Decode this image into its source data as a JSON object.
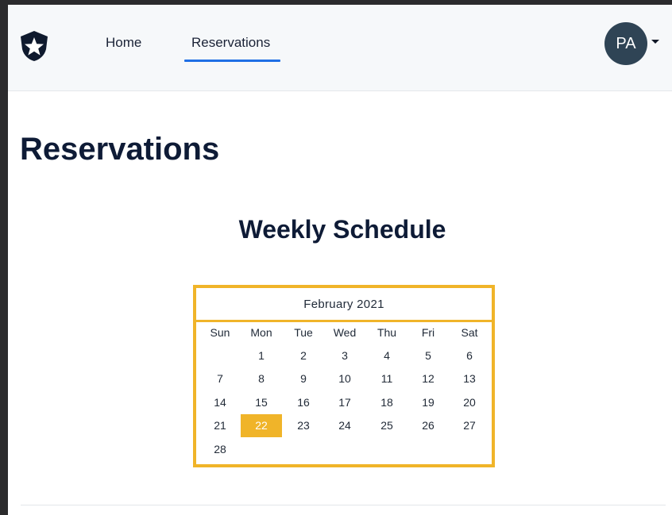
{
  "navbar": {
    "links": [
      {
        "label": "Home"
      },
      {
        "label": "Reservations",
        "active": true
      }
    ],
    "avatar_initials": "PA",
    "accent_color": "#1f6fe5"
  },
  "page": {
    "title": "Reservations",
    "section_title": "Weekly Schedule"
  },
  "calendar": {
    "month_label": "February  2021",
    "weekdays": [
      "Sun",
      "Mon",
      "Tue",
      "Wed",
      "Thu",
      "Fri",
      "Sat"
    ],
    "first_weekday_index": 1,
    "days_in_month": 28,
    "selected_day": 22,
    "highlight_color": "#f0b429"
  },
  "icons": {
    "logo": "star-shield-icon",
    "avatar_dropdown": "caret-down-icon"
  }
}
